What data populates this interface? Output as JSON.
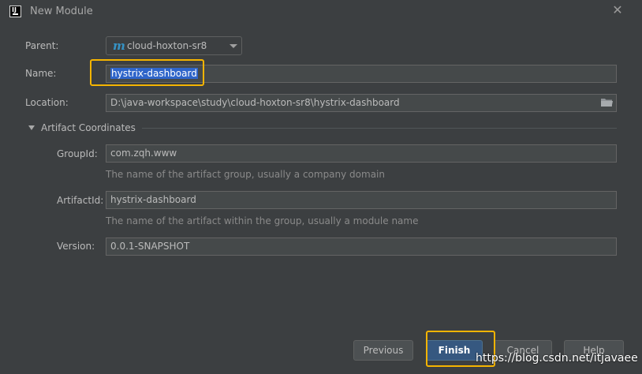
{
  "window": {
    "title": "New Module",
    "app_icon": "intellij-idea-icon",
    "close_icon": "close-icon"
  },
  "form": {
    "parent": {
      "label": "Parent:",
      "value": "cloud-hoxton-sr8",
      "icon": "maven-module-icon"
    },
    "name": {
      "label": "Name:",
      "value": "hystrix-dashboard"
    },
    "location": {
      "label": "Location:",
      "value": "D:\\java-workspace\\study\\cloud-hoxton-sr8\\hystrix-dashboard",
      "icon": "folder-icon"
    }
  },
  "artifact": {
    "section_label": "Artifact Coordinates",
    "expanded": true,
    "group_id": {
      "label": "GroupId:",
      "value": "com.zqh.www",
      "hint": "The name of the artifact group, usually a company domain"
    },
    "artifact_id": {
      "label": "ArtifactId:",
      "value": "hystrix-dashboard",
      "hint": "The name of the artifact within the group, usually a module name"
    },
    "version": {
      "label": "Version:",
      "value": "0.0.1-SNAPSHOT"
    }
  },
  "buttons": {
    "previous": "Previous",
    "finish": "Finish",
    "cancel": "Cancel",
    "help": "Help"
  },
  "watermark": "https://blog.csdn.net/itjavaee",
  "colors": {
    "background": "#3c3f41",
    "field_background": "#45494a",
    "selection": "#2f65ca",
    "primary_button": "#365880",
    "highlight_annotation": "#f5b400"
  }
}
